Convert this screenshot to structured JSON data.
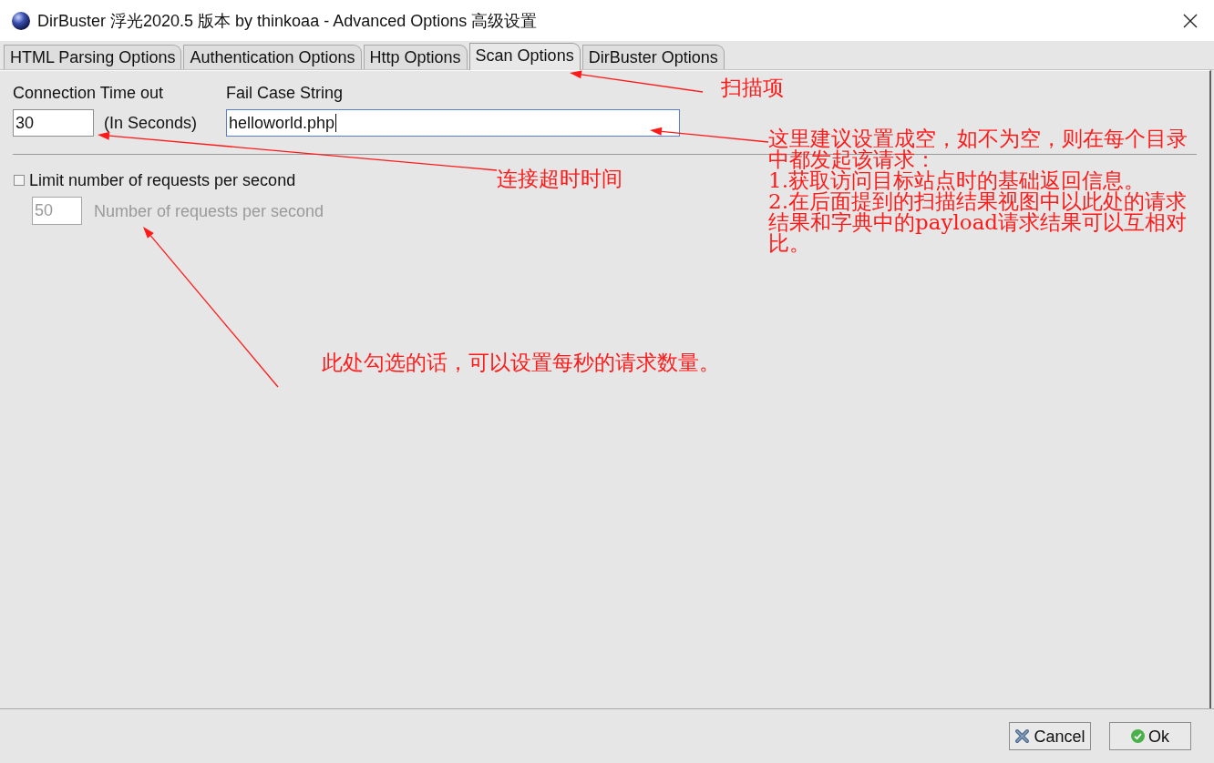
{
  "window": {
    "title": "DirBuster 浮光2020.5 版本 by thinkoaa - Advanced Options 高级设置"
  },
  "tabs": [
    {
      "label": "HTML Parsing Options",
      "selected": false
    },
    {
      "label": "Authentication Options",
      "selected": false
    },
    {
      "label": "Http Options",
      "selected": false
    },
    {
      "label": "Scan Options",
      "selected": true
    },
    {
      "label": "DirBuster Options",
      "selected": false
    }
  ],
  "scan_options": {
    "connection_timeout": {
      "label": "Connection Time out",
      "value": "30",
      "unit": "(In Seconds)"
    },
    "fail_case_string": {
      "label": "Fail Case String",
      "value": "helloworld.php",
      "focused": true
    },
    "limit_requests": {
      "label": "Limit number of requests per second",
      "checked": false
    },
    "requests_per_second": {
      "value": "50",
      "label": "Number of requests per second",
      "disabled": true
    }
  },
  "buttons": [
    {
      "kind": "cancel",
      "label": "Cancel"
    },
    {
      "kind": "ok",
      "label": "Ok"
    }
  ],
  "annotations": [
    {
      "paragraphs": [
        "扫描项"
      ]
    },
    {
      "paragraphs": [
        "连接超时时间"
      ]
    },
    {
      "paragraphs": [
        "这里建议设置成空，如不为空，则在每个目录中都发起该请求：",
        "1.获取访问目标站点时的基础返回信息。",
        "2.在后面提到的扫描结果视图中以此处的请求结果和字典中的payload请求结果可以互相对比。"
      ]
    },
    {
      "paragraphs": [
        "此处勾选的话，可以设置每秒的请求数量。"
      ]
    }
  ]
}
